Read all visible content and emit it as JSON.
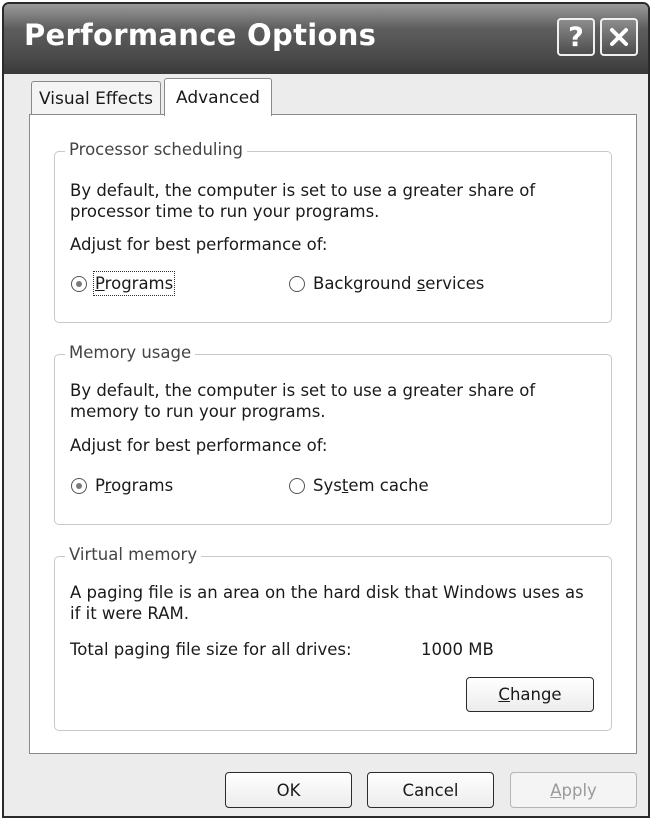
{
  "window": {
    "title": "Performance Options",
    "help_label": "?"
  },
  "tabs": [
    {
      "label": "Visual Effects",
      "selected": false
    },
    {
      "label": "Advanced",
      "selected": true
    }
  ],
  "processor_scheduling": {
    "legend": "Processor scheduling",
    "desc_line1": "By default, the computer is set to use a greater share of",
    "desc_line2": "processor time to run your programs.",
    "adjust_label": "Adjust for best performance of:",
    "option_programs": {
      "before": "",
      "accel": "P",
      "after": "rograms",
      "selected": true
    },
    "option_background": {
      "before": "Background ",
      "accel": "s",
      "after": "ervices",
      "selected": false
    }
  },
  "memory_usage": {
    "legend": "Memory usage",
    "desc_line1": "By default, the computer is set to use a greater share of",
    "desc_line2": "memory to run your programs.",
    "adjust_label": "Adjust for best performance of:",
    "option_programs": {
      "before": "P",
      "accel": "r",
      "after": "ograms",
      "selected": true
    },
    "option_cache": {
      "before": "Sys",
      "accel": "t",
      "after": "em cache",
      "selected": false
    }
  },
  "virtual_memory": {
    "legend": "Virtual memory",
    "desc_line1": "A paging file is an area on the hard disk that Windows uses as",
    "desc_line2": "if it were RAM.",
    "total_label": "Total paging file size for all drives:",
    "total_value": "1000 MB",
    "change_button": {
      "before": "",
      "accel": "C",
      "after": "hange"
    }
  },
  "buttons": {
    "ok": "OK",
    "cancel": "Cancel",
    "apply": {
      "before": "",
      "accel": "A",
      "after": "pply",
      "enabled": false
    }
  },
  "icons": {
    "help": "help-icon",
    "close": "close-icon",
    "radio": "radio-button"
  }
}
